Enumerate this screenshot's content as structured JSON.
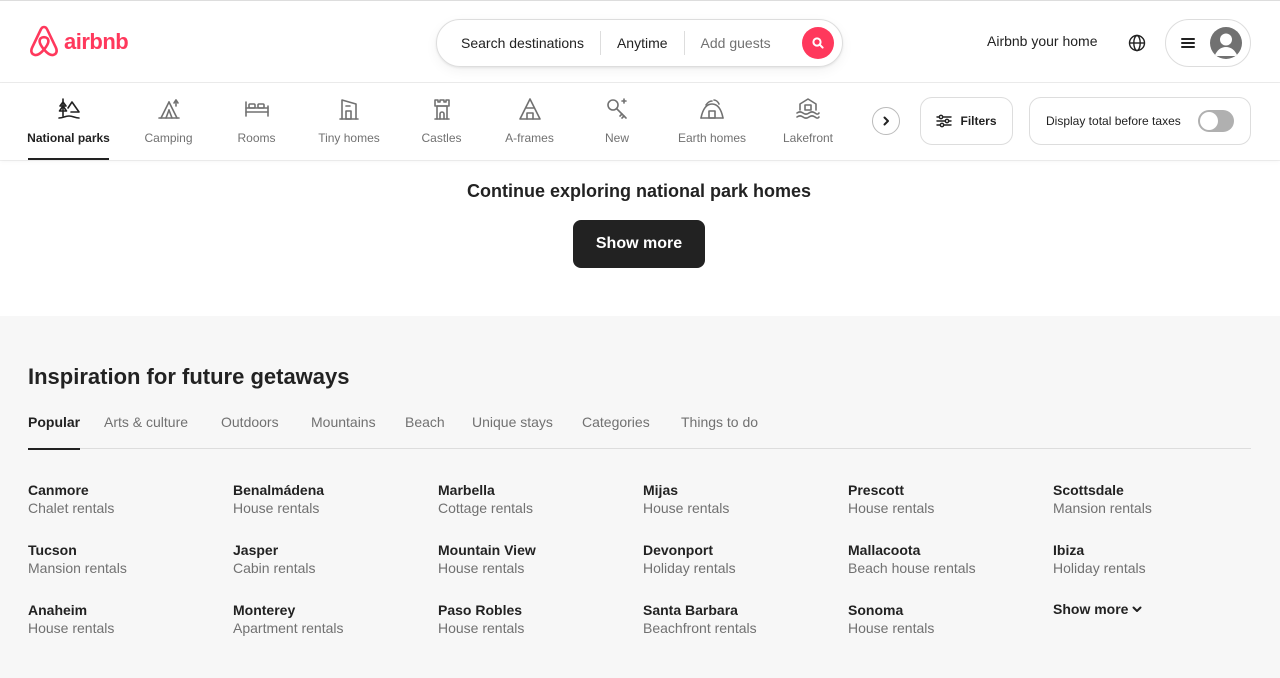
{
  "header": {
    "logo_text": "airbnb",
    "search": {
      "destination": "Search destinations",
      "dates": "Anytime",
      "guests": "Add guests"
    },
    "host_link": "Airbnb your home"
  },
  "categories": [
    {
      "label": "National parks",
      "icon": "national-park-icon",
      "active": true
    },
    {
      "label": "Camping",
      "icon": "tent-icon"
    },
    {
      "label": "Rooms",
      "icon": "bed-icon"
    },
    {
      "label": "Tiny homes",
      "icon": "tiny-home-icon"
    },
    {
      "label": "Castles",
      "icon": "castle-icon"
    },
    {
      "label": "A-frames",
      "icon": "a-frame-icon"
    },
    {
      "label": "New",
      "icon": "key-sparkle-icon"
    },
    {
      "label": "Earth homes",
      "icon": "earth-home-icon"
    },
    {
      "label": "Lakefront",
      "icon": "lakefront-icon"
    }
  ],
  "filters_label": "Filters",
  "taxes_label": "Display total before taxes",
  "continue": {
    "title": "Continue exploring national park homes",
    "button": "Show more"
  },
  "inspiration": {
    "title": "Inspiration for future getaways",
    "tabs": [
      "Popular",
      "Arts & culture",
      "Outdoors",
      "Mountains",
      "Beach",
      "Unique stays",
      "Categories",
      "Things to do"
    ],
    "destinations": [
      {
        "name": "Canmore",
        "type": "Chalet rentals"
      },
      {
        "name": "Benalmádena",
        "type": "House rentals"
      },
      {
        "name": "Marbella",
        "type": "Cottage rentals"
      },
      {
        "name": "Mijas",
        "type": "House rentals"
      },
      {
        "name": "Prescott",
        "type": "House rentals"
      },
      {
        "name": "Scottsdale",
        "type": "Mansion rentals"
      },
      {
        "name": "Tucson",
        "type": "Mansion rentals"
      },
      {
        "name": "Jasper",
        "type": "Cabin rentals"
      },
      {
        "name": "Mountain View",
        "type": "House rentals"
      },
      {
        "name": "Devonport",
        "type": "Holiday rentals"
      },
      {
        "name": "Mallacoota",
        "type": "Beach house rentals"
      },
      {
        "name": "Ibiza",
        "type": "Holiday rentals"
      },
      {
        "name": "Anaheim",
        "type": "House rentals"
      },
      {
        "name": "Monterey",
        "type": "Apartment rentals"
      },
      {
        "name": "Paso Robles",
        "type": "House rentals"
      },
      {
        "name": "Santa Barbara",
        "type": "Beachfront rentals"
      },
      {
        "name": "Sonoma",
        "type": "House rentals"
      }
    ],
    "show_more": "Show more"
  },
  "colors": {
    "brand": "#ff385c",
    "text": "#222222",
    "muted": "#717171"
  }
}
